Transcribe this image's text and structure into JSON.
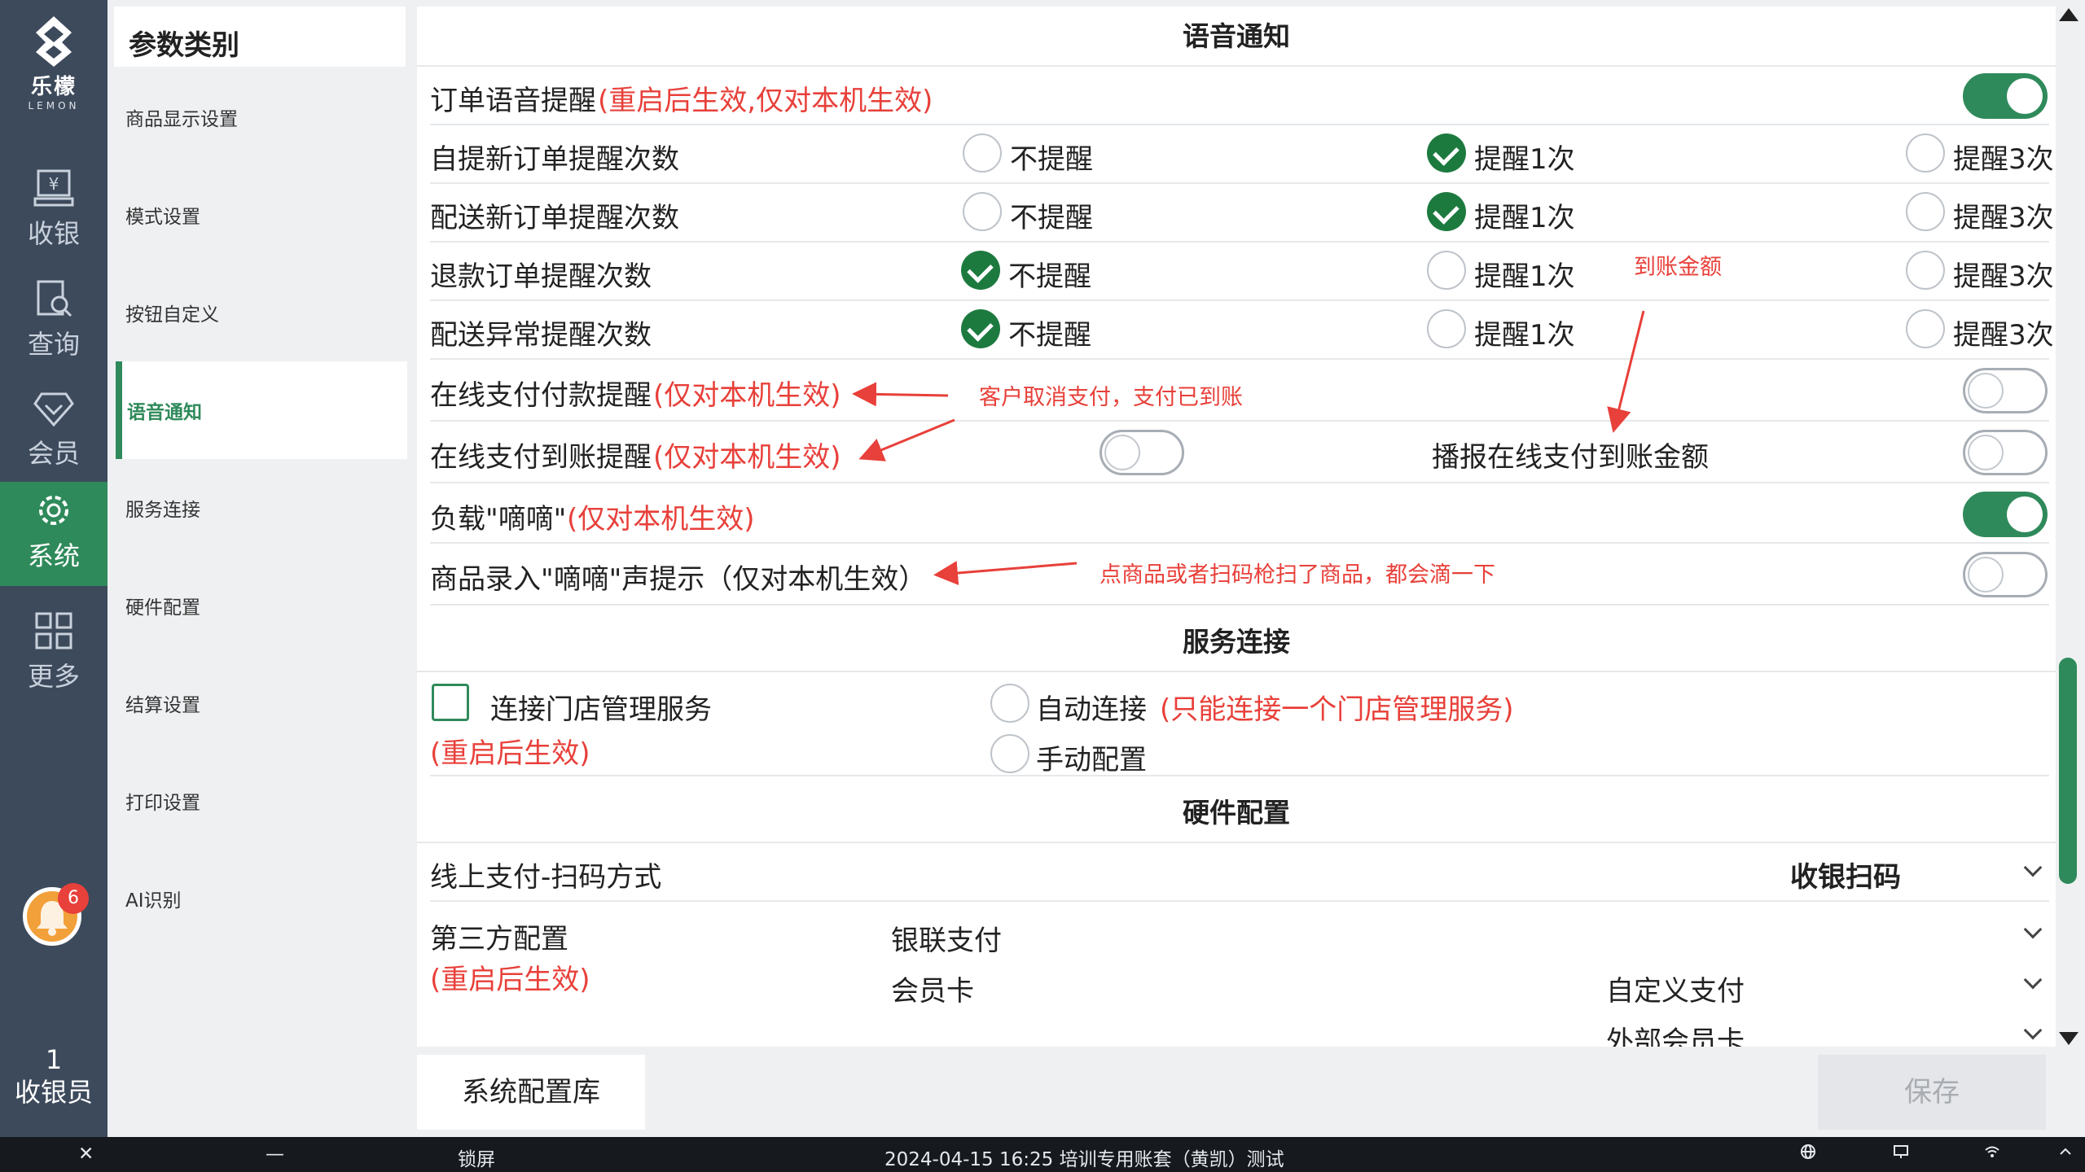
{
  "nav": {
    "logo_cn": "乐檬",
    "logo_en": "LEMON",
    "items": [
      {
        "label": "收银",
        "icon": "cashier-icon"
      },
      {
        "label": "查询",
        "icon": "search-document-icon"
      },
      {
        "label": "会员",
        "icon": "member-diamond-icon"
      },
      {
        "label": "系统",
        "icon": "gear-icon"
      },
      {
        "label": "更多",
        "icon": "grid-icon"
      }
    ],
    "notification_count": "6",
    "cashier_line1": "1",
    "cashier_line2": "收银员"
  },
  "categories": {
    "title": "参数类别",
    "items": [
      "商品显示设置",
      "模式设置",
      "按钮自定义",
      "语音通知",
      "服务连接",
      "硬件配置",
      "结算设置",
      "打印设置",
      "AI识别"
    ],
    "active_index": 3
  },
  "voice": {
    "title": "语音通知",
    "order_voice": {
      "label": "订单语音提醒",
      "note": "(重启后生效,仅对本机生效)",
      "on": true
    },
    "opt_none": "不提醒",
    "opt_once": "提醒1次",
    "opt_three": "提醒3次",
    "rows": [
      {
        "label": "自提新订单提醒次数",
        "selected": 1
      },
      {
        "label": "配送新订单提醒次数",
        "selected": 1
      },
      {
        "label": "退款订单提醒次数",
        "selected": 0
      },
      {
        "label": "配送异常提醒次数",
        "selected": 0
      }
    ],
    "online_pay": {
      "label": "在线支付付款提醒",
      "note": "(仅对本机生效)",
      "on": false
    },
    "online_arrive": {
      "label": "在线支付到账提醒",
      "note": "(仅对本机生效)",
      "on": false,
      "broadcast_label": "播报在线支付到账金额",
      "broadcast_on": false
    },
    "beep_load": {
      "label": "负载\"嘀嘀\"",
      "note": "(仅对本机生效)",
      "on": true
    },
    "beep_entry": {
      "label": "商品录入\"嘀嘀\"声提示（仅对本机生效）",
      "on": false
    }
  },
  "annotations": {
    "cancel_pay": "客户取消支付，支付已到账",
    "arrive_amount": "到账金额",
    "beep_hint": "点商品或者扫码枪扫了商品，都会滴一下"
  },
  "service": {
    "title": "服务连接",
    "connect_label": "连接门店管理服务",
    "restart_note": "(重启后生效)",
    "auto_label": "自动连接",
    "auto_note": "(只能连接一个门店管理服务)",
    "manual_label": "手动配置"
  },
  "hardware": {
    "title": "硬件配置",
    "scan_label": "线上支付-扫码方式",
    "scan_value": "收银扫码",
    "third_label": "第三方配置",
    "third_note": "(重启后生效)",
    "unionpay": "银联支付",
    "member_card": "会员卡",
    "custom_pay": "自定义支付",
    "external_card": "外部会员卡"
  },
  "footer": {
    "library_btn": "系统配置库",
    "save_btn": "保存"
  },
  "statusbar": {
    "close": "✕",
    "minimize": "—",
    "lock": "锁屏",
    "info": "2024-04-15 16:25 培训专用账套（黄凯）测试",
    "icons": [
      "globe-icon",
      "monitor-icon",
      "wifi-icon",
      "chevron-up-icon"
    ]
  },
  "colors": {
    "accent": "#2f8a5b",
    "nav_bg": "#3d4a5c",
    "alert_red": "#e8403a"
  }
}
